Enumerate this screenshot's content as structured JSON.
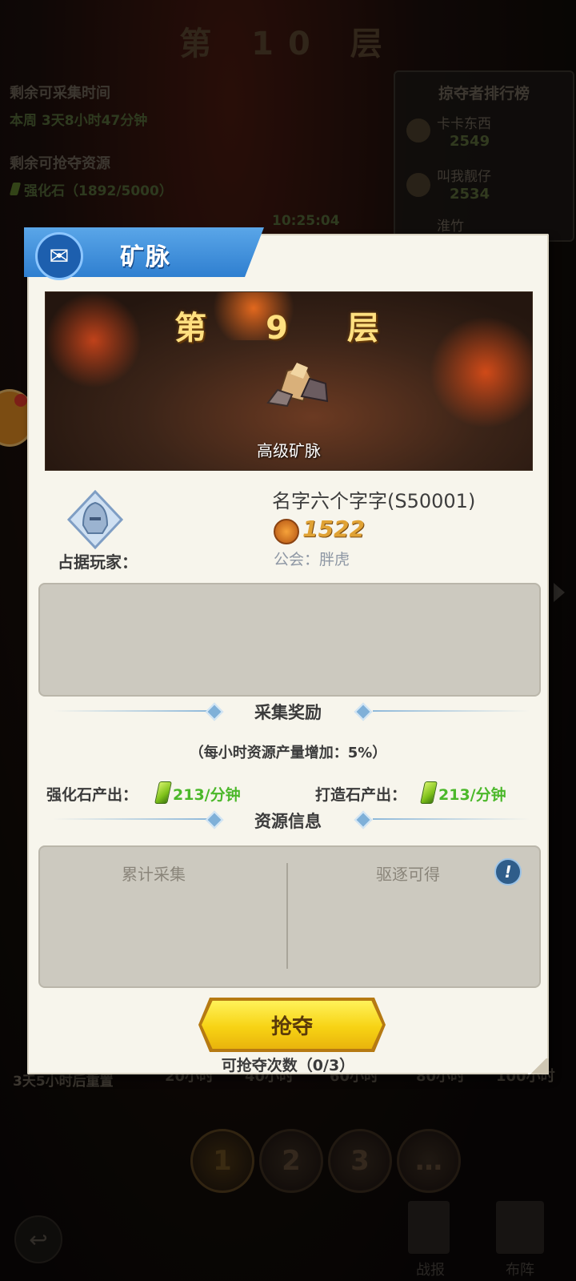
{
  "background": {
    "floor_title": "第 10 层",
    "remaining_collect_label": "剩余可采集时间",
    "remaining_collect_value": "本周 3天8小时47分钟",
    "remaining_rob_label": "剩余可抢夺资源",
    "remaining_rob_value": "强化石（1892/5000）",
    "timer": "10:25:04",
    "reset_text": "3天5小时后重置",
    "timeline": [
      "20小时",
      "40小时",
      "60小时",
      "80小时",
      "100小时"
    ],
    "page_buttons": [
      "1",
      "2",
      "3",
      "…"
    ],
    "bottom_buttons": {
      "report": "战报",
      "formation": "布阵"
    },
    "leaderboard": {
      "title": "掠夺者排行榜",
      "entries": [
        {
          "name": "卡卡东西",
          "value": "2549"
        },
        {
          "name": "叫我靓仔",
          "value": "2534"
        },
        {
          "name": "淮竹",
          "value": ""
        }
      ]
    }
  },
  "modal": {
    "title": "矿脉",
    "banner": {
      "floor": "第 9 层",
      "label": "高级矿脉"
    },
    "occupant": {
      "label": "占据玩家：",
      "name": "名字六个字字(S50001)",
      "power": "1522",
      "guild": "公会：胖虎"
    },
    "rewards": {
      "title": "采集奖励",
      "bonus": "（每小时资源产量增加：5%）",
      "strengthen_label": "强化石产出：",
      "strengthen_value": "213/分钟",
      "forge_label": "打造石产出：",
      "forge_value": "213/分钟"
    },
    "resources": {
      "title": "资源信息",
      "collected_label": "累计采集",
      "expel_label": "驱逐可得"
    },
    "rob_button": "抢夺",
    "rob_count": "可抢夺次数（0/3）"
  },
  "colors": {
    "ribbon": "#2f7fd0",
    "button": "#f7d314",
    "production": "#4bb82a",
    "power": "#e0a234"
  }
}
